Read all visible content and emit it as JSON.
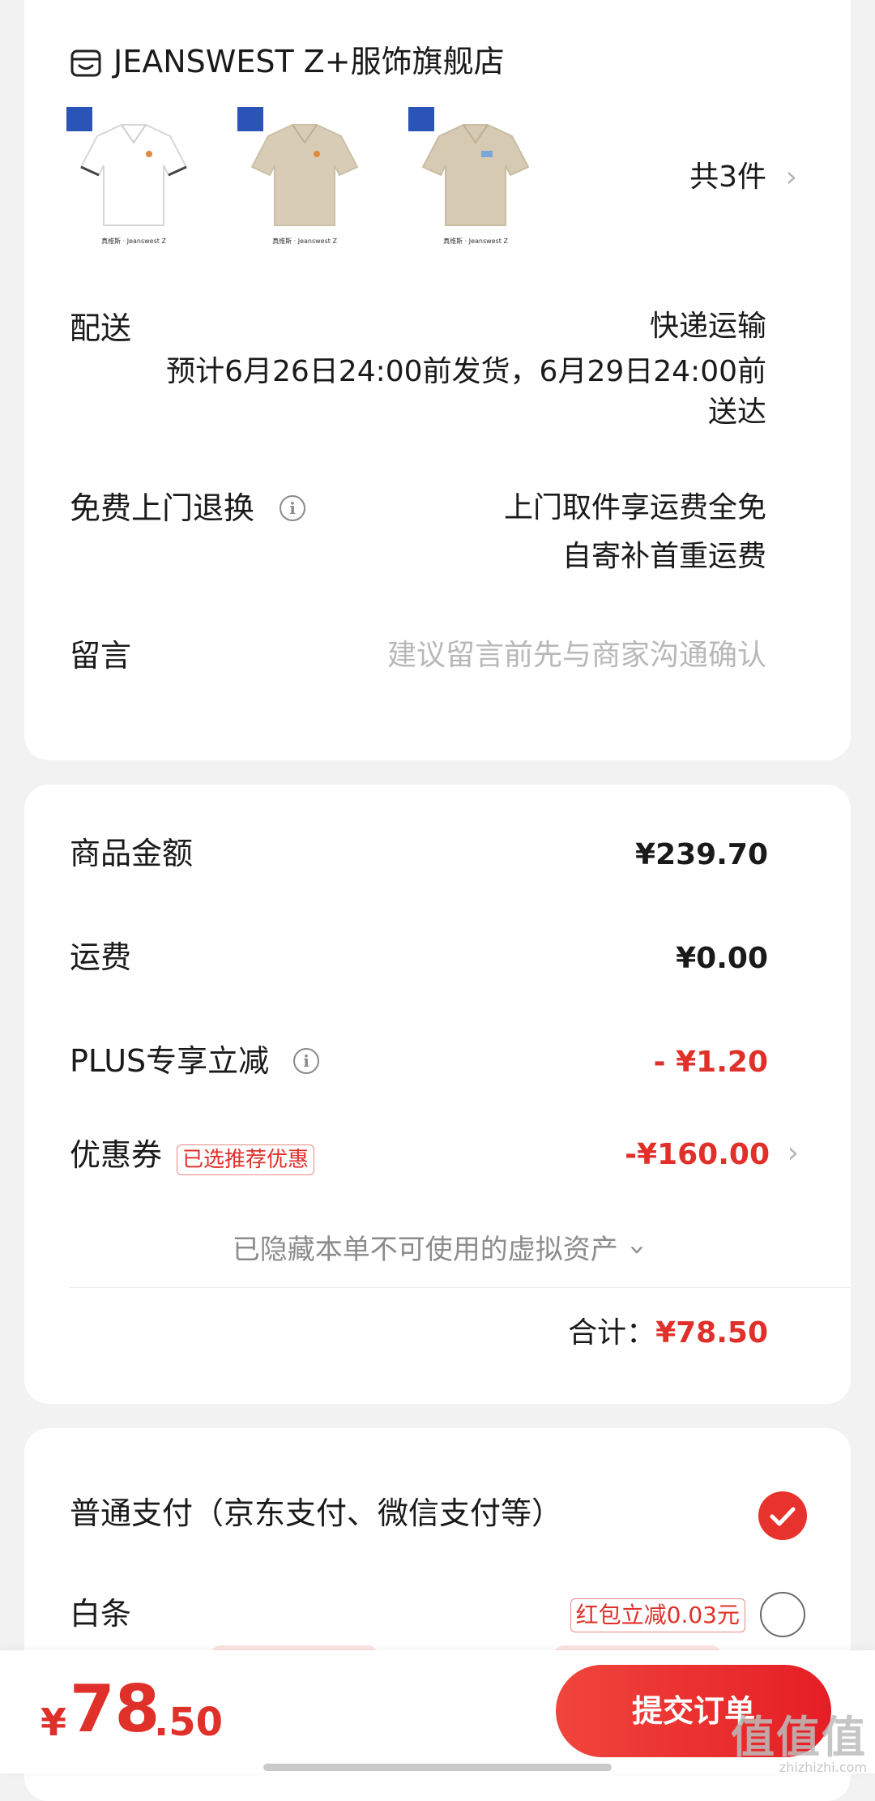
{
  "shop": {
    "name": "JEANSWEST Z+服饰旗舰店",
    "item_count": "共3件",
    "products": [
      {
        "color": "#ffffff",
        "brand_text": "真维斯 · Jeanswest Z"
      },
      {
        "color": "#d8ccb6",
        "brand_text": "真维斯 · Jeanswest Z"
      },
      {
        "color": "#d6cab3",
        "brand_text": "真维斯 · Jeanswest Z"
      }
    ]
  },
  "delivery": {
    "label": "配送",
    "method": "快递运输",
    "estimate_line1": "预计6月26日24:00前发货，6月29日24:00前",
    "estimate_line2": "送达"
  },
  "returns": {
    "label": "免费上门退换",
    "line1": "上门取件享运费全免",
    "line2": "自寄补首重运费"
  },
  "message": {
    "label": "留言",
    "placeholder": "建议留言前先与商家沟通确认"
  },
  "summary": {
    "goods_label": "商品金额",
    "goods_value": "¥239.70",
    "shipping_label": "运费",
    "shipping_value": "¥0.00",
    "plus_label": "PLUS专享立减",
    "plus_value": "- ¥1.20",
    "coupon_label": "优惠券",
    "coupon_tag": "已选推荐优惠",
    "coupon_value": "-¥160.00",
    "hidden_note": "已隐藏本单不可使用的虚拟资产",
    "total_label": "合计：",
    "total_value": "¥78.50"
  },
  "payment": {
    "normal_label": "普通支付（京东支付、微信支付等）",
    "baitiao_label": "白条",
    "baitiao_tag": "红包立减0.03元"
  },
  "bottom": {
    "yen": "¥",
    "amount_int": "78",
    "amount_dec": ".50",
    "submit_label": "提交订单",
    "watermark": "值值值",
    "watermark_url": "zhizhizhi.com"
  },
  "colors": {
    "accent_red": "#e0302a",
    "button_red": "#e51e25"
  }
}
